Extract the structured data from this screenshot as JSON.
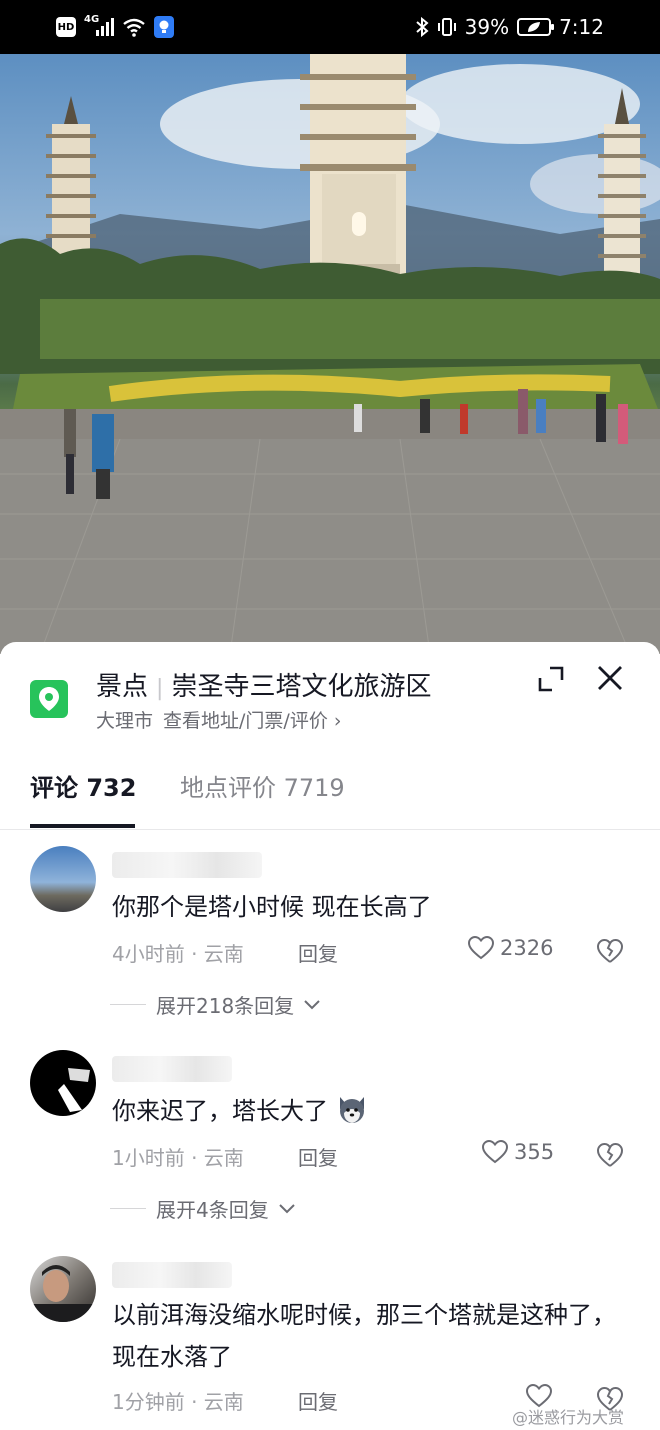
{
  "status_bar": {
    "network_label": "4G",
    "battery_percent": "39%",
    "time": "7:12"
  },
  "poi": {
    "category": "景点",
    "name": "崇圣寺三塔文化旅游区",
    "city": "大理市",
    "link_text": "查看地址/门票/评价 ›"
  },
  "tabs": [
    {
      "label": "评论 732",
      "active": true
    },
    {
      "label": "地点评价 7719",
      "active": false
    }
  ],
  "comments": [
    {
      "text": "你那个是塔小时候  现在长高了",
      "meta": "4小时前 · 云南",
      "reply_label": "回复",
      "likes": "2326",
      "expand_label": "展开218条回复"
    },
    {
      "text": "你来迟了，塔长大了",
      "emoji_icon": "husky-dog-emoji-icon",
      "meta": "1小时前 · 云南",
      "reply_label": "回复",
      "likes": "355",
      "expand_label": "展开4条回复"
    },
    {
      "text": "以前洱海没缩水呢时候，那三个塔就是这种了，现在水落了",
      "meta": "1分钟前 · 云南",
      "reply_label": "回复",
      "likes": ""
    }
  ],
  "watermark": "@迷惑行为大赏",
  "colors": {
    "poi_icon": "#27c35b",
    "text_primary": "#161823",
    "text_secondary": "#85868c"
  }
}
